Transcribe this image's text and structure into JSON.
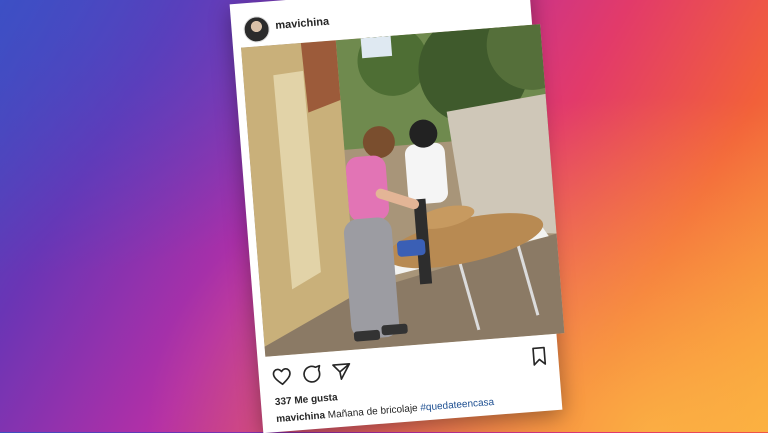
{
  "post": {
    "username": "mavichina",
    "likes_text": "337 Me gusta",
    "caption_username": "mavichina",
    "caption_text": " Mañana de bricolaje ",
    "hashtag": "#quedateencasa"
  },
  "icons": {
    "like": "heart-icon",
    "comment": "comment-icon",
    "share": "send-icon",
    "save": "bookmark-icon"
  },
  "colors": {
    "text": "#262626",
    "hashtag": "#1d4f91"
  }
}
